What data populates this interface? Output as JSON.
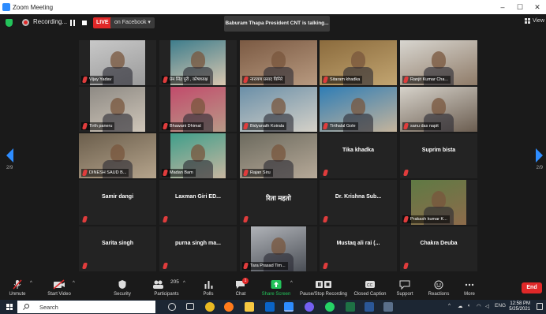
{
  "window": {
    "title": "Zoom Meeting",
    "controls": [
      "–",
      "☐",
      "✕"
    ]
  },
  "topbar": {
    "recording_label": "Recording...",
    "live_label": "LIVE",
    "stream_label": "on Facebook ▾",
    "talking": "Baburam Thapa President CNT is talking...",
    "view_label": "View"
  },
  "gallery": {
    "page_left": "2/9",
    "page_right": "2/9",
    "tiles": [
      {
        "name": "Vijay Yadav",
        "video": true
      },
      {
        "name": "प्रेम सिंह पुरी , कोषाध्यक्ष",
        "video": true
      },
      {
        "name": "नारायण प्रसाद घिमिरे",
        "video": true
      },
      {
        "name": "Sitaram khadka",
        "video": true
      },
      {
        "name": "Ranjit Kumar Cha...",
        "video": true
      },
      {
        "name": "Tirth paneru",
        "video": true
      },
      {
        "name": "Bhawani Dhimal",
        "video": true
      },
      {
        "name": "Bidyanath Koirala",
        "video": true
      },
      {
        "name": "Tirthalal Gole",
        "video": true
      },
      {
        "name": "sanu das napit",
        "video": true
      },
      {
        "name": "DINESH SAUD B...",
        "video": true
      },
      {
        "name": "Madan Bam",
        "video": true
      },
      {
        "name": "Rajan Siru",
        "video": true
      },
      {
        "name": "Tika khadka",
        "video": false
      },
      {
        "name": "Suprim bista",
        "video": false
      },
      {
        "name": "Samir dangi",
        "video": false
      },
      {
        "name": "Laxman Giri ED...",
        "video": false
      },
      {
        "name": "रिता महतो",
        "video": false
      },
      {
        "name": "Dr. Krishna Sub...",
        "video": false
      },
      {
        "name": "Prakash kumar K...",
        "video": true
      },
      {
        "name": "Sarita singh",
        "video": false
      },
      {
        "name": "purna singh ma...",
        "video": false
      },
      {
        "name": "Tara Prasad Tim...",
        "video": true
      },
      {
        "name": "Mustaq ali rai (...",
        "video": false
      },
      {
        "name": "Chakra Deuba",
        "video": false
      }
    ]
  },
  "toolbar": {
    "unmute": "Unmute",
    "start_video": "Start Video",
    "security": "Security",
    "participants": "Participants",
    "participants_count": "205",
    "polls": "Polls",
    "chat": "Chat",
    "chat_badge": "1",
    "share_screen": "Share Screen",
    "recording": "Pause/Stop Recording",
    "closed_caption": "Closed Caption",
    "support": "Support",
    "reactions": "Reactions",
    "more": "More",
    "end": "End"
  },
  "taskbar": {
    "search_placeholder": "Search",
    "language": "ENG",
    "time": "12:58 PM",
    "date": "5/25/2021"
  },
  "colors": {
    "accent": "#2d8cff",
    "danger": "#e02828",
    "share": "#23c35a"
  }
}
